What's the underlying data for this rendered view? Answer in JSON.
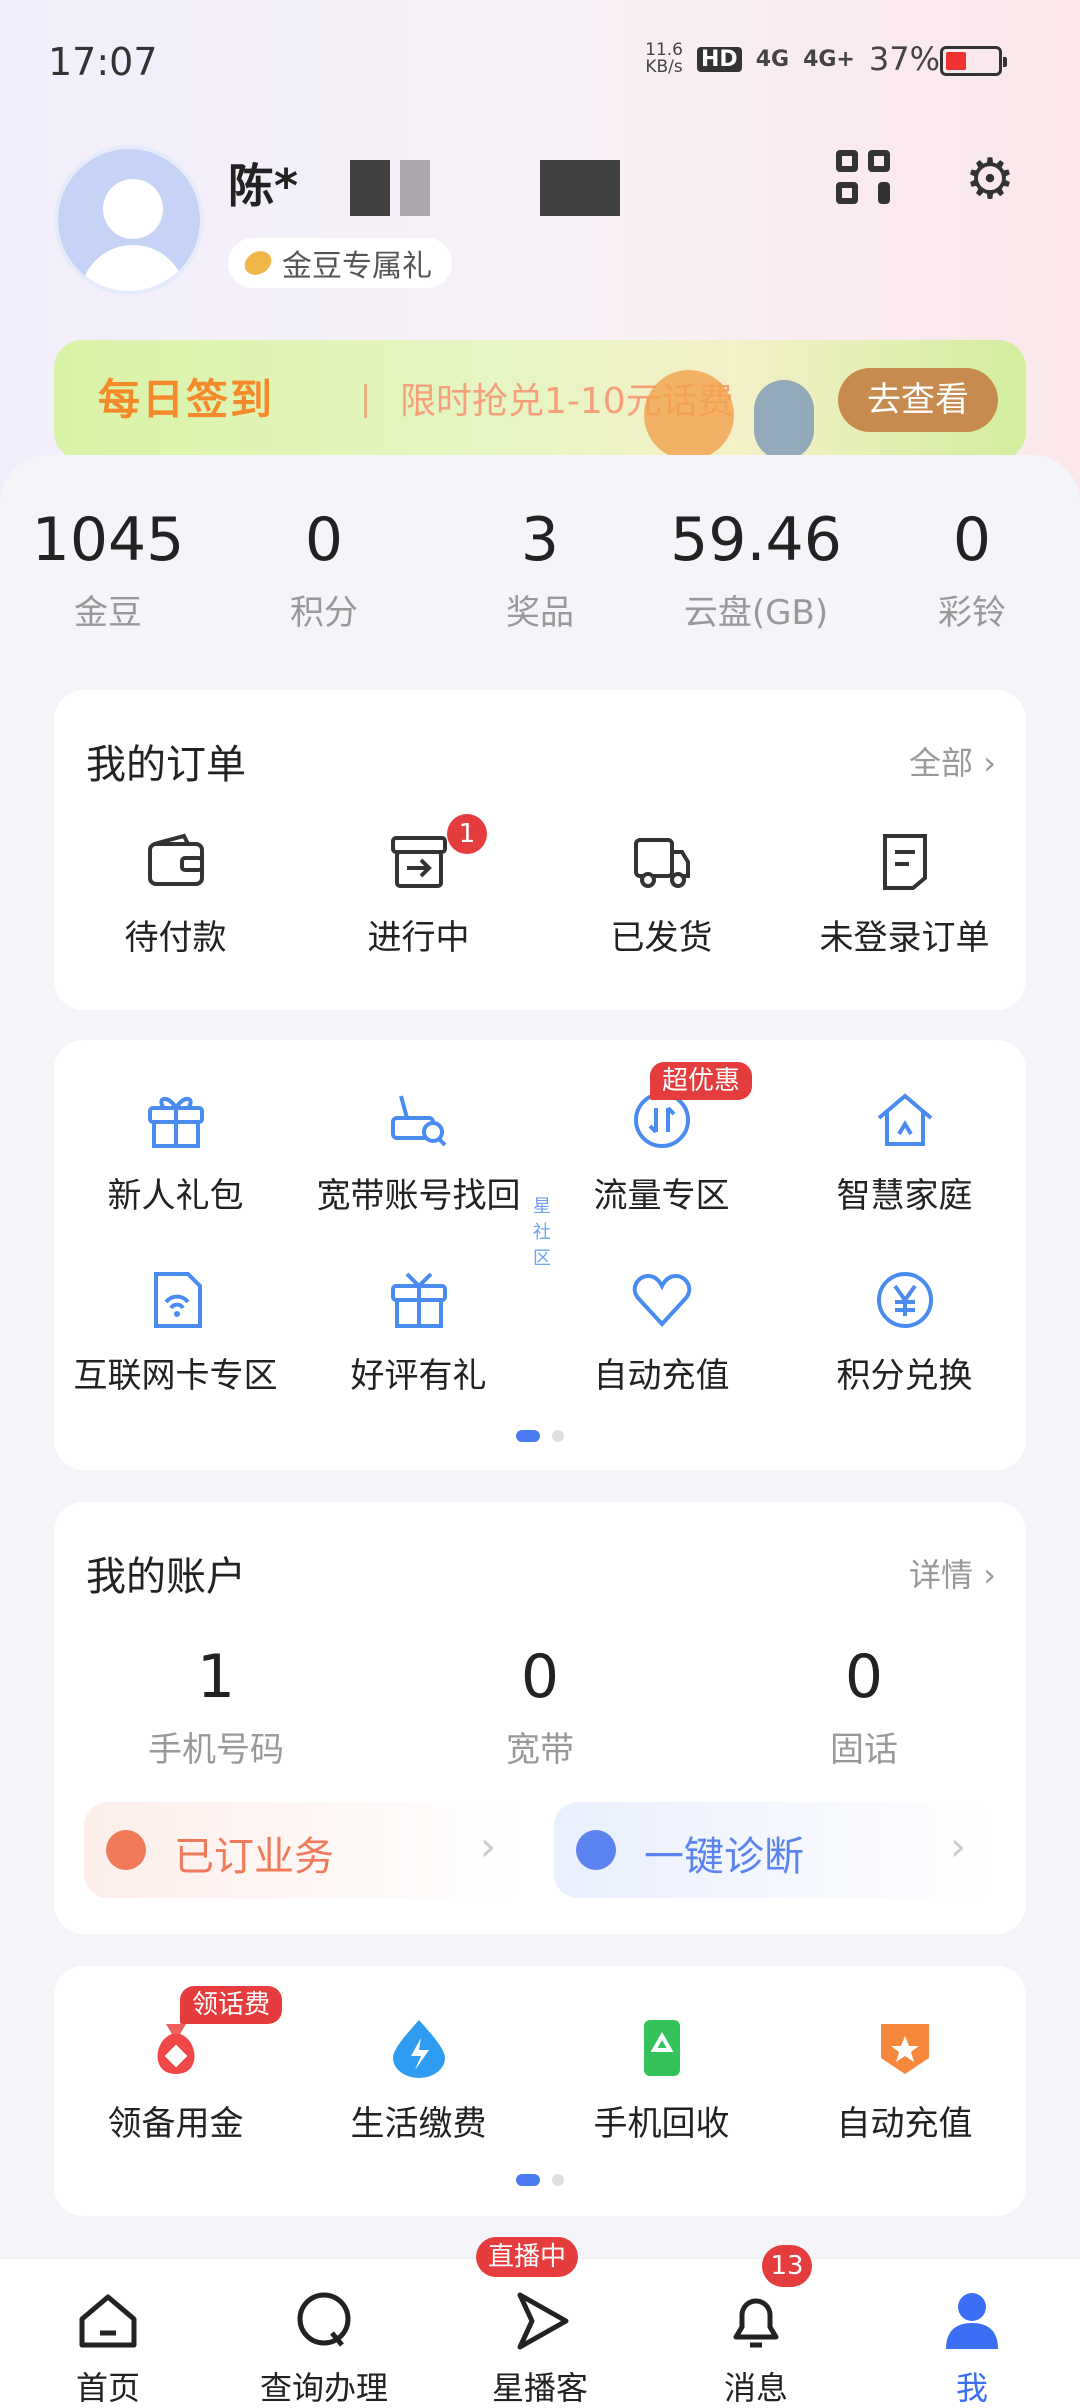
{
  "status": {
    "time": "17:07",
    "netspeed": "11.6\nKB/s",
    "hd": "HD",
    "sig1": "4G",
    "sig2": "4G+",
    "battery": "37%"
  },
  "profile": {
    "name": "陈*",
    "tag": "金豆专属礼"
  },
  "banner": {
    "title": "每日签到",
    "subtitle": "限时抢兑1-10元话费",
    "button": "去查看"
  },
  "stats": [
    {
      "value": "1045",
      "label": "金豆"
    },
    {
      "value": "0",
      "label": "积分"
    },
    {
      "value": "3",
      "label": "奖品"
    },
    {
      "value": "59.46",
      "label": "云盘(GB)"
    },
    {
      "value": "0",
      "label": "彩铃"
    }
  ],
  "orders": {
    "title": "我的订单",
    "more": "全部",
    "items": [
      {
        "label": "待付款",
        "icon": "wallet-icon"
      },
      {
        "label": "进行中",
        "icon": "box-icon",
        "badge": "1"
      },
      {
        "label": "已发货",
        "icon": "truck-icon"
      },
      {
        "label": "未登录订单",
        "icon": "document-icon"
      }
    ]
  },
  "services": {
    "row1": [
      {
        "label": "新人礼包",
        "icon": "gift-icon"
      },
      {
        "label": "宽带账号找回",
        "icon": "router-search-icon"
      },
      {
        "label": "流量专区",
        "icon": "data-icon",
        "badge": "超优惠"
      },
      {
        "label": "智慧家庭",
        "icon": "home-icon"
      }
    ],
    "row2": [
      {
        "label": "互联网卡专区",
        "icon": "sim-icon"
      },
      {
        "label": "好评有礼",
        "icon": "gift-box-icon"
      },
      {
        "label": "自动充值",
        "icon": "heart-icon"
      },
      {
        "label": "积分兑换",
        "icon": "yen-icon"
      }
    ],
    "watermark": "星社区"
  },
  "account": {
    "title": "我的账户",
    "more": "详情",
    "items": [
      {
        "value": "1",
        "label": "手机号码"
      },
      {
        "value": "0",
        "label": "宽带"
      },
      {
        "value": "0",
        "label": "固话"
      }
    ],
    "pill1": "已订业务",
    "pill2": "一键诊断"
  },
  "tools": {
    "items": [
      {
        "label": "领备用金",
        "icon": "money-bag-icon",
        "badge": "领话费"
      },
      {
        "label": "生活缴费",
        "icon": "lightning-icon"
      },
      {
        "label": "手机回收",
        "icon": "phone-recycle-icon"
      },
      {
        "label": "自动充值",
        "icon": "star-shield-icon"
      }
    ]
  },
  "tabbar": {
    "items": [
      {
        "label": "首页",
        "icon": "home-tab-icon"
      },
      {
        "label": "查询办理",
        "icon": "search-tab-icon"
      },
      {
        "label": "星播客",
        "icon": "play-tab-icon",
        "badge": "直播中"
      },
      {
        "label": "消息",
        "icon": "bell-tab-icon",
        "badge": "13"
      },
      {
        "label": "我",
        "icon": "user-tab-icon"
      }
    ]
  },
  "colors": {
    "accent": "#3b6ff5",
    "badge": "#e53d3d",
    "banner_btn": "#c78b4f"
  }
}
